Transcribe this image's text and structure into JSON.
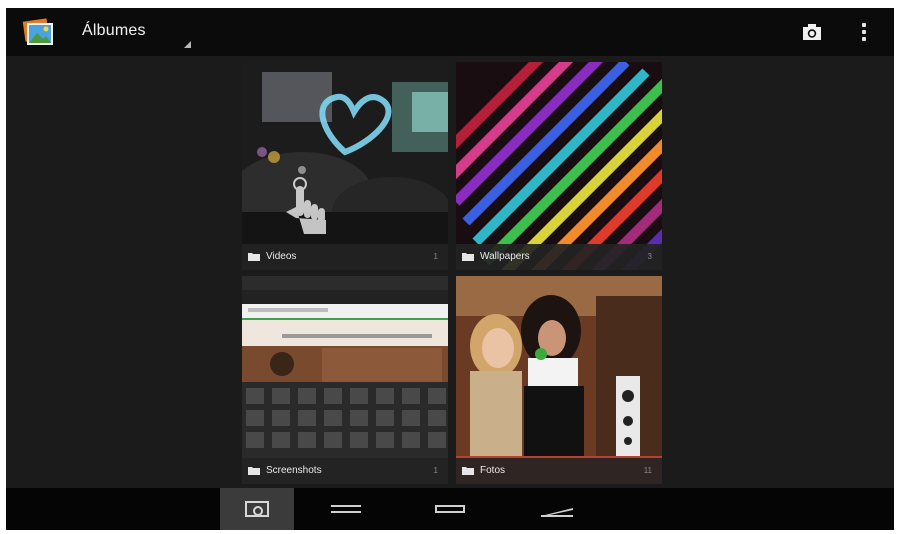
{
  "action_bar": {
    "title": "Álbumes",
    "app_icon": "gallery-icon",
    "actions": [
      {
        "name": "camera",
        "icon": "camera-icon"
      },
      {
        "name": "overflow-menu",
        "icon": "overflow-menu-icon"
      }
    ]
  },
  "albums": [
    {
      "label": "Videos",
      "count": "1",
      "icon": "folder-icon"
    },
    {
      "label": "Wallpapers",
      "count": "3",
      "icon": "folder-icon"
    },
    {
      "label": "Screenshots",
      "count": "1",
      "icon": "folder-icon"
    },
    {
      "label": "Fotos",
      "count": "11",
      "icon": "folder-icon"
    }
  ],
  "nav_bar": {
    "items": [
      "camera-icon",
      "back-icon",
      "home-icon",
      "recent-apps-icon"
    ],
    "active": "camera-icon"
  },
  "colors": {
    "action_bar_bg": "#0b0b0b",
    "content_bg": "#1b1b1b",
    "nav_bar_bg": "#050505",
    "label_bar_bg": "#232323"
  }
}
